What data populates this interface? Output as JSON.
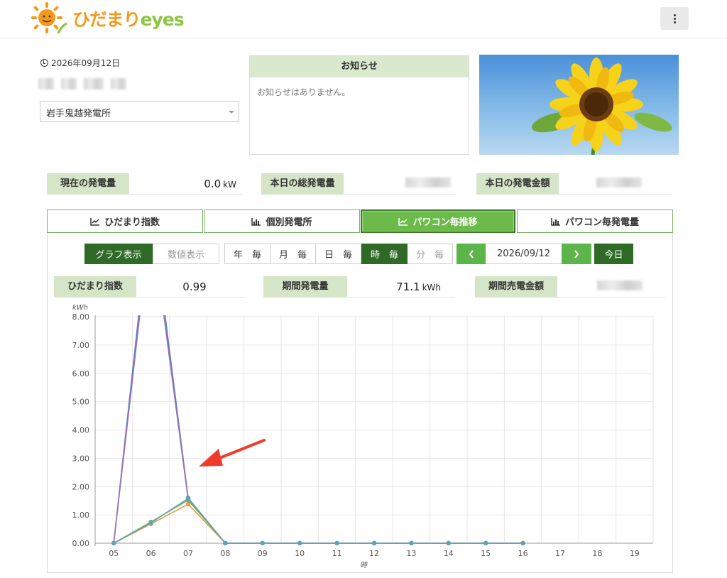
{
  "header": {
    "logo_part1": "ひだまり",
    "logo_part2": "eyes"
  },
  "info": {
    "date": "2026年09月12日",
    "plant_select_value": "岩手鬼越発電所"
  },
  "notice": {
    "title": "お知らせ",
    "body": "お知らせはありません。"
  },
  "kpis": {
    "current_label": "現在の発電量",
    "current_value": "0.0",
    "current_unit": "kW",
    "total_today_label": "本日の総発電量",
    "amount_today_label": "本日の発電金額"
  },
  "tabs": [
    {
      "label": "ひだまり指数",
      "icon": "line-chart-icon"
    },
    {
      "label": "個別発電所",
      "icon": "bar-chart-icon"
    },
    {
      "label": "パワコン毎推移",
      "icon": "line-chart-icon",
      "active": true
    },
    {
      "label": "パワコン毎発電量",
      "icon": "bar-chart-icon"
    }
  ],
  "view_toggle": {
    "graph": "グラフ表示",
    "numeric": "数値表示"
  },
  "period": {
    "year": "年　毎",
    "month": "月　毎",
    "day": "日　毎",
    "hour": "時　毎",
    "minute": "分　毎"
  },
  "date_nav": {
    "value": "2026/09/12",
    "today": "今日"
  },
  "stats": {
    "index_label": "ひだまり指数",
    "index_value": "0.99",
    "period_gen_label": "期間発電量",
    "period_gen_value": "71.1",
    "period_gen_unit": "kWh",
    "period_sales_label": "期間売電金額"
  },
  "colors": {
    "accent_green": "#6cbb4a",
    "dark_green": "#2f6b26",
    "label_bg": "#d5e5c8",
    "arrow_red": "#f03a2a"
  },
  "chart_data": {
    "type": "line",
    "ylabel": "kWh",
    "xlabel": "時",
    "ylim": [
      0,
      8
    ],
    "y_ticks": [
      "0.00",
      "1.00",
      "2.00",
      "3.00",
      "4.00",
      "5.00",
      "6.00",
      "7.00",
      "8.00"
    ],
    "categories": [
      "05",
      "06",
      "07",
      "08",
      "09",
      "10",
      "11",
      "12",
      "13",
      "14",
      "15",
      "16",
      "17",
      "18",
      "19"
    ],
    "grid": true,
    "series": [
      {
        "color": "#5b7fc4",
        "values": [
          0,
          12,
          1.6,
          0,
          0,
          0,
          0,
          0,
          0,
          0,
          0,
          0,
          null,
          null,
          null
        ]
      },
      {
        "color": "#9c6fb0",
        "values": [
          0,
          11.5,
          1.55,
          0,
          0,
          0,
          0,
          0,
          0,
          0,
          0,
          0,
          null,
          null,
          null
        ]
      },
      {
        "color": "#e99a3b",
        "values": [
          0,
          0.68,
          1.38,
          0,
          0,
          0,
          0,
          0,
          0,
          0,
          0,
          0,
          null,
          null,
          null
        ]
      },
      {
        "color": "#7bb25a",
        "values": [
          0,
          0.75,
          1.52,
          0,
          0,
          0,
          0,
          0,
          0,
          0,
          0,
          0,
          null,
          null,
          null
        ]
      },
      {
        "color": "#5fa2b8",
        "values": [
          0,
          0.72,
          1.58,
          0,
          0,
          0,
          0,
          0,
          0,
          0,
          0,
          0,
          null,
          null,
          null
        ]
      }
    ]
  }
}
